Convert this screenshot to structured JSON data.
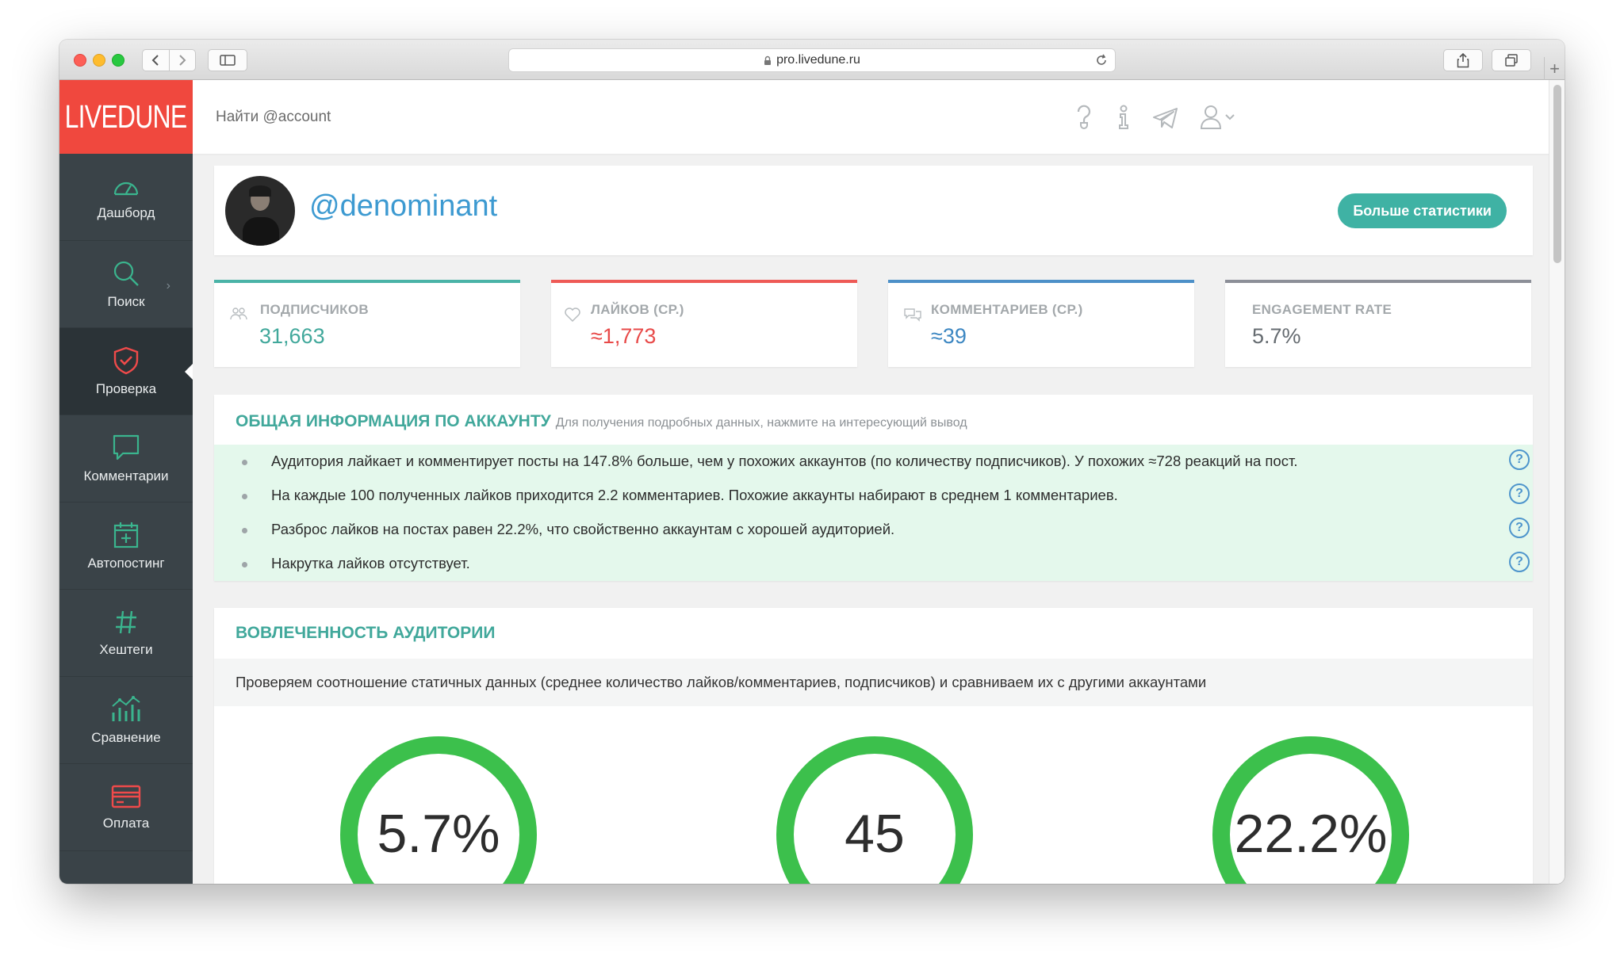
{
  "browser": {
    "url": "pro.livedune.ru"
  },
  "app": {
    "logo": "LIVEDUNE",
    "search_placeholder": "Найти @account"
  },
  "sidebar": {
    "items": [
      {
        "label": "Дашборд",
        "icon": "speedometer-icon"
      },
      {
        "label": "Поиск",
        "icon": "search-icon"
      },
      {
        "label": "Проверка",
        "icon": "shield-check-icon",
        "active": true
      },
      {
        "label": "Комментарии",
        "icon": "comment-icon"
      },
      {
        "label": "Автопостинг",
        "icon": "calendar-plus-icon"
      },
      {
        "label": "Хештеги",
        "icon": "hashtag-icon"
      },
      {
        "label": "Сравнение",
        "icon": "compare-chart-icon"
      },
      {
        "label": "Оплата",
        "icon": "credit-card-icon"
      }
    ]
  },
  "profile": {
    "handle": "@denominant",
    "more_stats_button": "Больше статистики"
  },
  "stats": [
    {
      "label": "ПОДПИСЧИКОВ",
      "value": "31,663"
    },
    {
      "label": "ЛАЙКОВ (СР.)",
      "value": "≈1,773"
    },
    {
      "label": "КОММЕНТАРИЕВ (СР.)",
      "value": "≈39"
    },
    {
      "label": "ENGAGEMENT RATE",
      "value": "5.7%"
    }
  ],
  "info": {
    "title": "ОБЩАЯ ИНФОРМАЦИЯ ПО АККАУНТУ",
    "subtitle": "Для получения подробных данных, нажмите на интересующий вывод",
    "items": [
      "Аудитория лайкает и комментирует посты на 147.8% больше, чем у похожих аккаунтов (по количеству подписчиков). У похожих ≈728 реакций на пост.",
      "На каждые 100 полученных лайков приходится 2.2 комментариев. Похожие аккаунты набирают в среднем 1 комментариев.",
      "Разброс лайков на постах равен 22.2%, что свойственно аккаунтам с хорошей аудиторией.",
      "Накрутка лайков отсутствует."
    ],
    "help_symbol": "?"
  },
  "engagement": {
    "title": "ВОВЛЕЧЕННОСТЬ АУДИТОРИИ",
    "description": "Проверяем соотношение статичных данных (среднее количество лайков/комментариев, подписчиков) и сравниваем их с другими аккаунтами",
    "gauges": [
      {
        "value": "5.7%"
      },
      {
        "value": "45"
      },
      {
        "value": "22.2%"
      }
    ]
  },
  "colors": {
    "brand_red": "#f0483e",
    "sidebar_bg": "#3a4348",
    "teal": "#41a89b",
    "gauge_green": "#3cc04c",
    "link_blue": "#3d9ad1"
  }
}
